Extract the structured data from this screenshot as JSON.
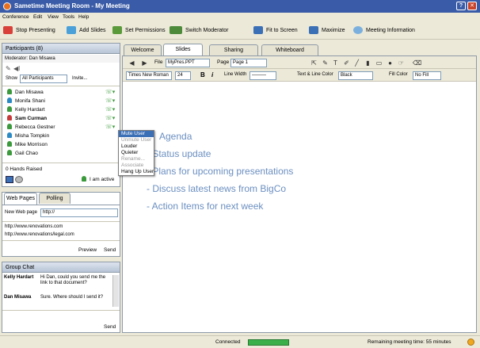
{
  "window": {
    "title": "Sametime Meeting Room - My Meeting"
  },
  "menubar": {
    "items": [
      "Conference",
      "Edit",
      "View",
      "Tools",
      "Help"
    ]
  },
  "toolbar": {
    "stop_presenting": "Stop Presenting",
    "add_slides": "Add Slides",
    "set_permissions": "Set Permissions",
    "switch_moderator": "Switch Moderator",
    "fit_to_screen": "Fit to Screen",
    "maximize": "Maximize",
    "meeting_information": "Meeting Information"
  },
  "participants": {
    "header": "Participants (8)",
    "moderator": "Moderator: Dan Misawa",
    "show_label": "Show",
    "show_value": "All Participants",
    "invite": "Invite...",
    "list": [
      "Dan Misawa",
      "Monifa Shani",
      "Kelly Hardart",
      "Sam Curman",
      "Rebecca Gestner",
      "Misha Tompkin",
      "Mike Morrison",
      "Gail Chao"
    ],
    "hands_raised": "0 Hands Raised",
    "status_text": "I am active"
  },
  "context_menu": {
    "items": [
      "Mute User",
      "Unmute User",
      "Louder",
      "Quieter",
      "Rename...",
      "Associate",
      "Hang Up User"
    ]
  },
  "web_pages": {
    "tabs": [
      "Web Pages",
      "Polling"
    ],
    "label": "New Web page",
    "url_value": "http://",
    "links": [
      "http://www.renovations.com",
      "http://www.renovations/legal.com"
    ],
    "preview": "Preview",
    "send": "Send"
  },
  "group_chat": {
    "header": "Group Chat",
    "messages": [
      {
        "name": "Kelly Hardart",
        "text": "Hi Dan, could you send me the link to that document?"
      },
      {
        "name": "Dan Misawa",
        "text": "Sure. Where should I send it?"
      }
    ],
    "send": "Send"
  },
  "main_tabs": {
    "items": [
      "Welcome",
      "Slides",
      "Sharing",
      "Whiteboard"
    ],
    "active": "Slides"
  },
  "slides_toolbar": {
    "file_label": "File",
    "file_value": "MyPres.PPT",
    "page_label": "Page",
    "page_value": "Page 1"
  },
  "format_toolbar": {
    "font": "Times New Roman",
    "size": "24",
    "bold": "B",
    "italic": "i",
    "line_width_label": "Line Width",
    "text_line_color_label": "Text & Line Color",
    "text_line_color_value": "Black",
    "fill_color_label": "Fill Color",
    "fill_color_value": "No Fill"
  },
  "slide": {
    "title": "Agenda",
    "bullets": [
      "- Status update",
      "- Plans for upcoming presentations",
      "- Discuss latest news from BigCo",
      "- Action Items for next week"
    ]
  },
  "status_bar": {
    "connection": "Connected",
    "remaining": "Remaining meeting time: 55 minutes"
  }
}
